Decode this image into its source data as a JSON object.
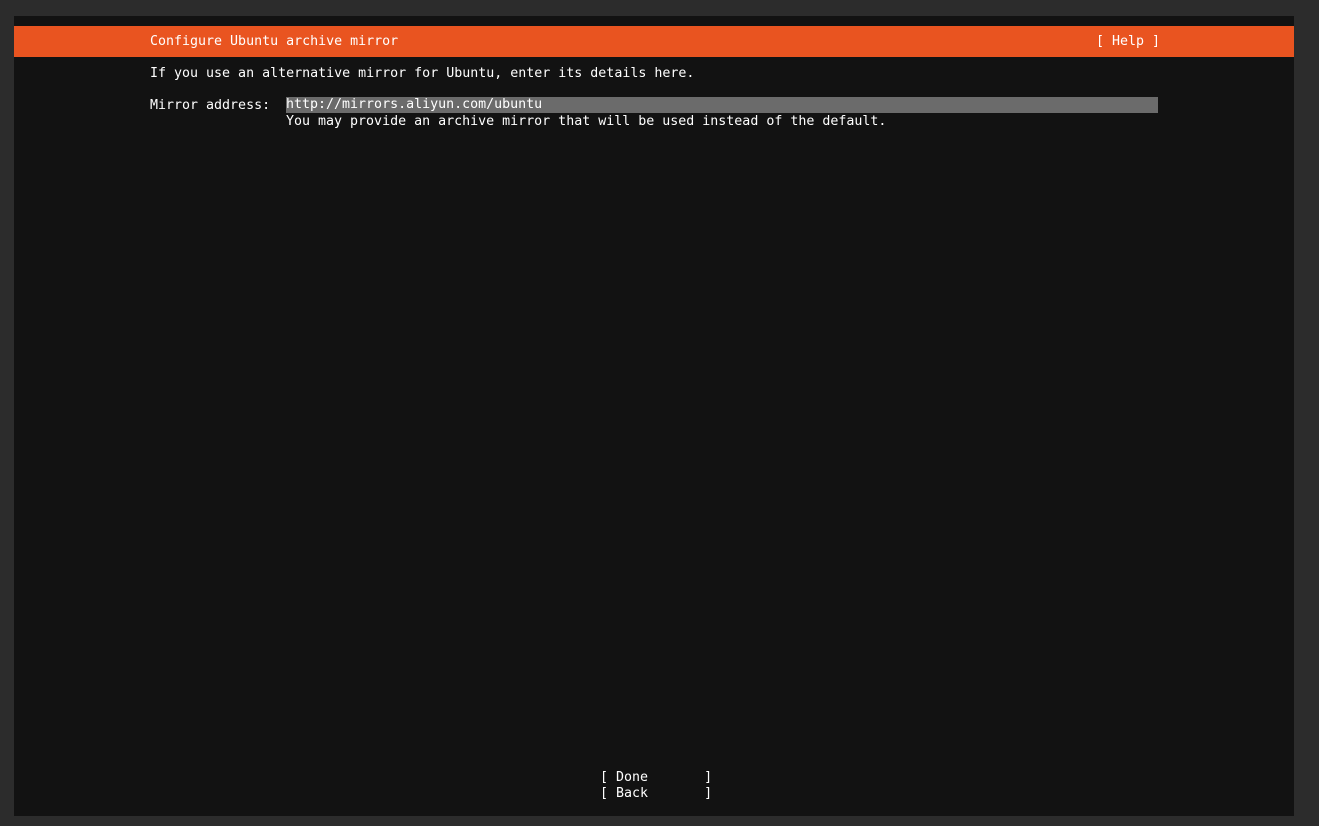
{
  "header": {
    "title": "Configure Ubuntu archive mirror",
    "help_label": "[ Help ]"
  },
  "intro_text": "If you use an alternative mirror for Ubuntu, enter its details here.",
  "mirror": {
    "label": "Mirror address:",
    "value": "http://mirrors.aliyun.com/ubuntu",
    "hint": "You may provide an archive mirror that will be used instead of the default."
  },
  "buttons": {
    "done_label": "[ Done       ]",
    "back_label": "[ Back       ]"
  },
  "colors": {
    "header_bg": "#e95420",
    "screen_bg": "#121212",
    "input_bg": "#6b6b6b",
    "text": "#ffffff"
  }
}
